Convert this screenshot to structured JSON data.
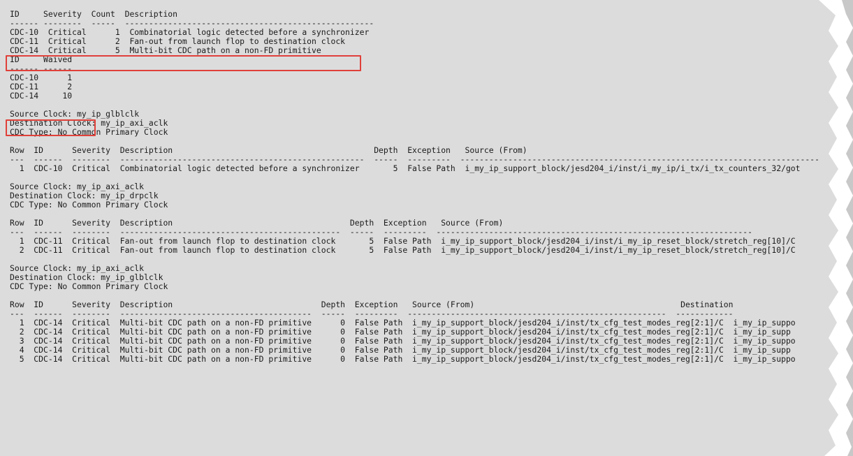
{
  "report": {
    "lines": [
      "ID     Severity  Count  Description",
      "------ --------  -----  ----------------------------------------------------",
      "CDC-10  Critical      1  Combinatorial logic detected before a synchronizer",
      "CDC-11  Critical      2  Fan-out from launch flop to destination clock",
      "CDC-14  Critical      5  Multi-bit CDC path on a non-FD primitive",
      "ID     Waived",
      "------ ------",
      "CDC-10      1",
      "CDC-11      2",
      "CDC-14     10",
      "",
      "Source Clock: my_ip_glblclk",
      "Destination Clock: my_ip_axi_aclk",
      "CDC Type: No Common Primary Clock",
      "",
      "Row  ID      Severity  Description                                          Depth  Exception   Source (From)",
      "---  ------  --------  ---------------------------------------------------  -----  ---------  ---------------------------------------------------------------------------",
      "  1  CDC-10  Critical  Combinatorial logic detected before a synchronizer       5  False Path  i_my_ip_support_block/jesd204_i/inst/i_my_ip/i_tx/i_tx_counters_32/got",
      "",
      "Source Clock: my_ip_axi_aclk",
      "Destination Clock: my_ip_drpclk",
      "CDC Type: No Common Primary Clock",
      "",
      "Row  ID      Severity  Description                                     Depth  Exception   Source (From)",
      "---  ------  --------  ----------------------------------------------  -----  ---------  ------------------------------------------------------------------",
      "  1  CDC-11  Critical  Fan-out from launch flop to destination clock       5  False Path  i_my_ip_support_block/jesd204_i/inst/i_my_ip_reset_block/stretch_reg[10]/C",
      "  2  CDC-11  Critical  Fan-out from launch flop to destination clock       5  False Path  i_my_ip_support_block/jesd204_i/inst/i_my_ip_reset_block/stretch_reg[10]/C",
      "",
      "Source Clock: my_ip_axi_aclk",
      "Destination Clock: my_ip_glblclk",
      "CDC Type: No Common Primary Clock",
      "",
      "Row  ID      Severity  Description                               Depth  Exception   Source (From)                                           Destination",
      "---  ------  --------  ----------------------------------------  -----  ---------  ------------------------------------------------------  ------------",
      "  1  CDC-14  Critical  Multi-bit CDC path on a non-FD primitive      0  False Path  i_my_ip_support_block/jesd204_i/inst/tx_cfg_test_modes_reg[2:1]/C  i_my_ip_suppo",
      "  2  CDC-14  Critical  Multi-bit CDC path on a non-FD primitive      0  False Path  i_my_ip_support_block/jesd204_i/inst/tx_cfg_test_modes_reg[2:1]/C  i_my_ip_supp",
      "  3  CDC-14  Critical  Multi-bit CDC path on a non-FD primitive      0  False Path  i_my_ip_support_block/jesd204_i/inst/tx_cfg_test_modes_reg[2:1]/C  i_my_ip_suppo",
      "  4  CDC-14  Critical  Multi-bit CDC path on a non-FD primitive      0  False Path  i_my_ip_support_block/jesd204_i/inst/tx_cfg_test_modes_reg[2:1]/C  i_my_ip_supp",
      "  5  CDC-14  Critical  Multi-bit CDC path on a non-FD primitive      0  False Path  i_my_ip_support_block/jesd204_i/inst/tx_cfg_test_modes_reg[2:1]/C  i_my_ip_suppo"
    ]
  },
  "highlight": {
    "color": "#e0403a"
  },
  "terminal": {
    "background": "#dcdcdc",
    "text_color": "#1a1a1a"
  }
}
